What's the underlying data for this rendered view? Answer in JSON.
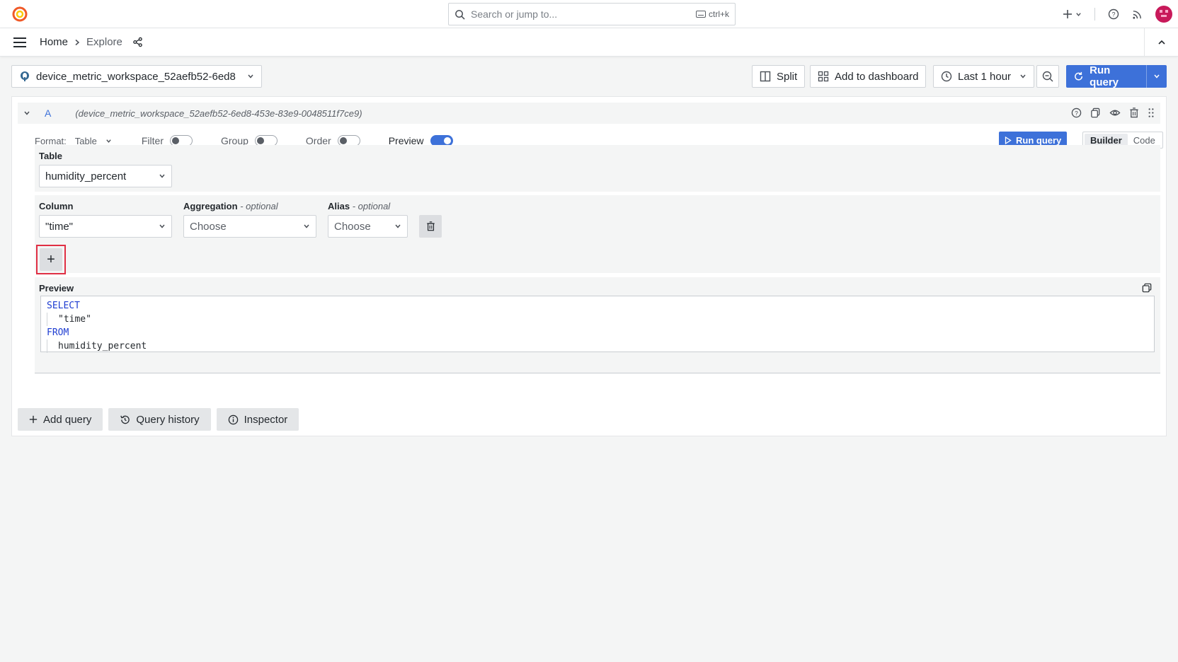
{
  "header": {
    "search_placeholder": "Search or jump to...",
    "search_shortcut": "ctrl+k"
  },
  "breadcrumb": {
    "home": "Home",
    "current": "Explore"
  },
  "toolbar": {
    "datasource": "device_metric_workspace_52aefb52-6ed8",
    "split": "Split",
    "add_to_dashboard": "Add to dashboard",
    "time_range": "Last 1 hour",
    "run_query": "Run query"
  },
  "query": {
    "letter": "A",
    "datasource_full": "(device_metric_workspace_52aefb52-6ed8-453e-83e9-0048511f7ce9)",
    "format_label": "Format:",
    "format_value": "Table",
    "filter_label": "Filter",
    "group_label": "Group",
    "order_label": "Order",
    "preview_label": "Preview",
    "run_query": "Run query",
    "mode_builder": "Builder",
    "mode_code": "Code",
    "table_label": "Table",
    "table_value": "humidity_percent",
    "column_label": "Column",
    "column_value": "\"time\"",
    "aggregation_label": "Aggregation",
    "aggregation_hint": "- optional",
    "aggregation_placeholder": "Choose",
    "alias_label": "Alias",
    "alias_hint": "- optional",
    "alias_placeholder": "Choose",
    "add_column": "+",
    "preview_title": "Preview",
    "sql": {
      "select": "SELECT",
      "col": "\"time\"",
      "from": "FROM",
      "table": "humidity_percent"
    }
  },
  "footer": {
    "add_query": "Add query",
    "query_history": "Query history",
    "inspector": "Inspector"
  },
  "colors": {
    "primary": "#3d71d9",
    "highlight": "#e02f44",
    "avatar": "#c8195a"
  }
}
